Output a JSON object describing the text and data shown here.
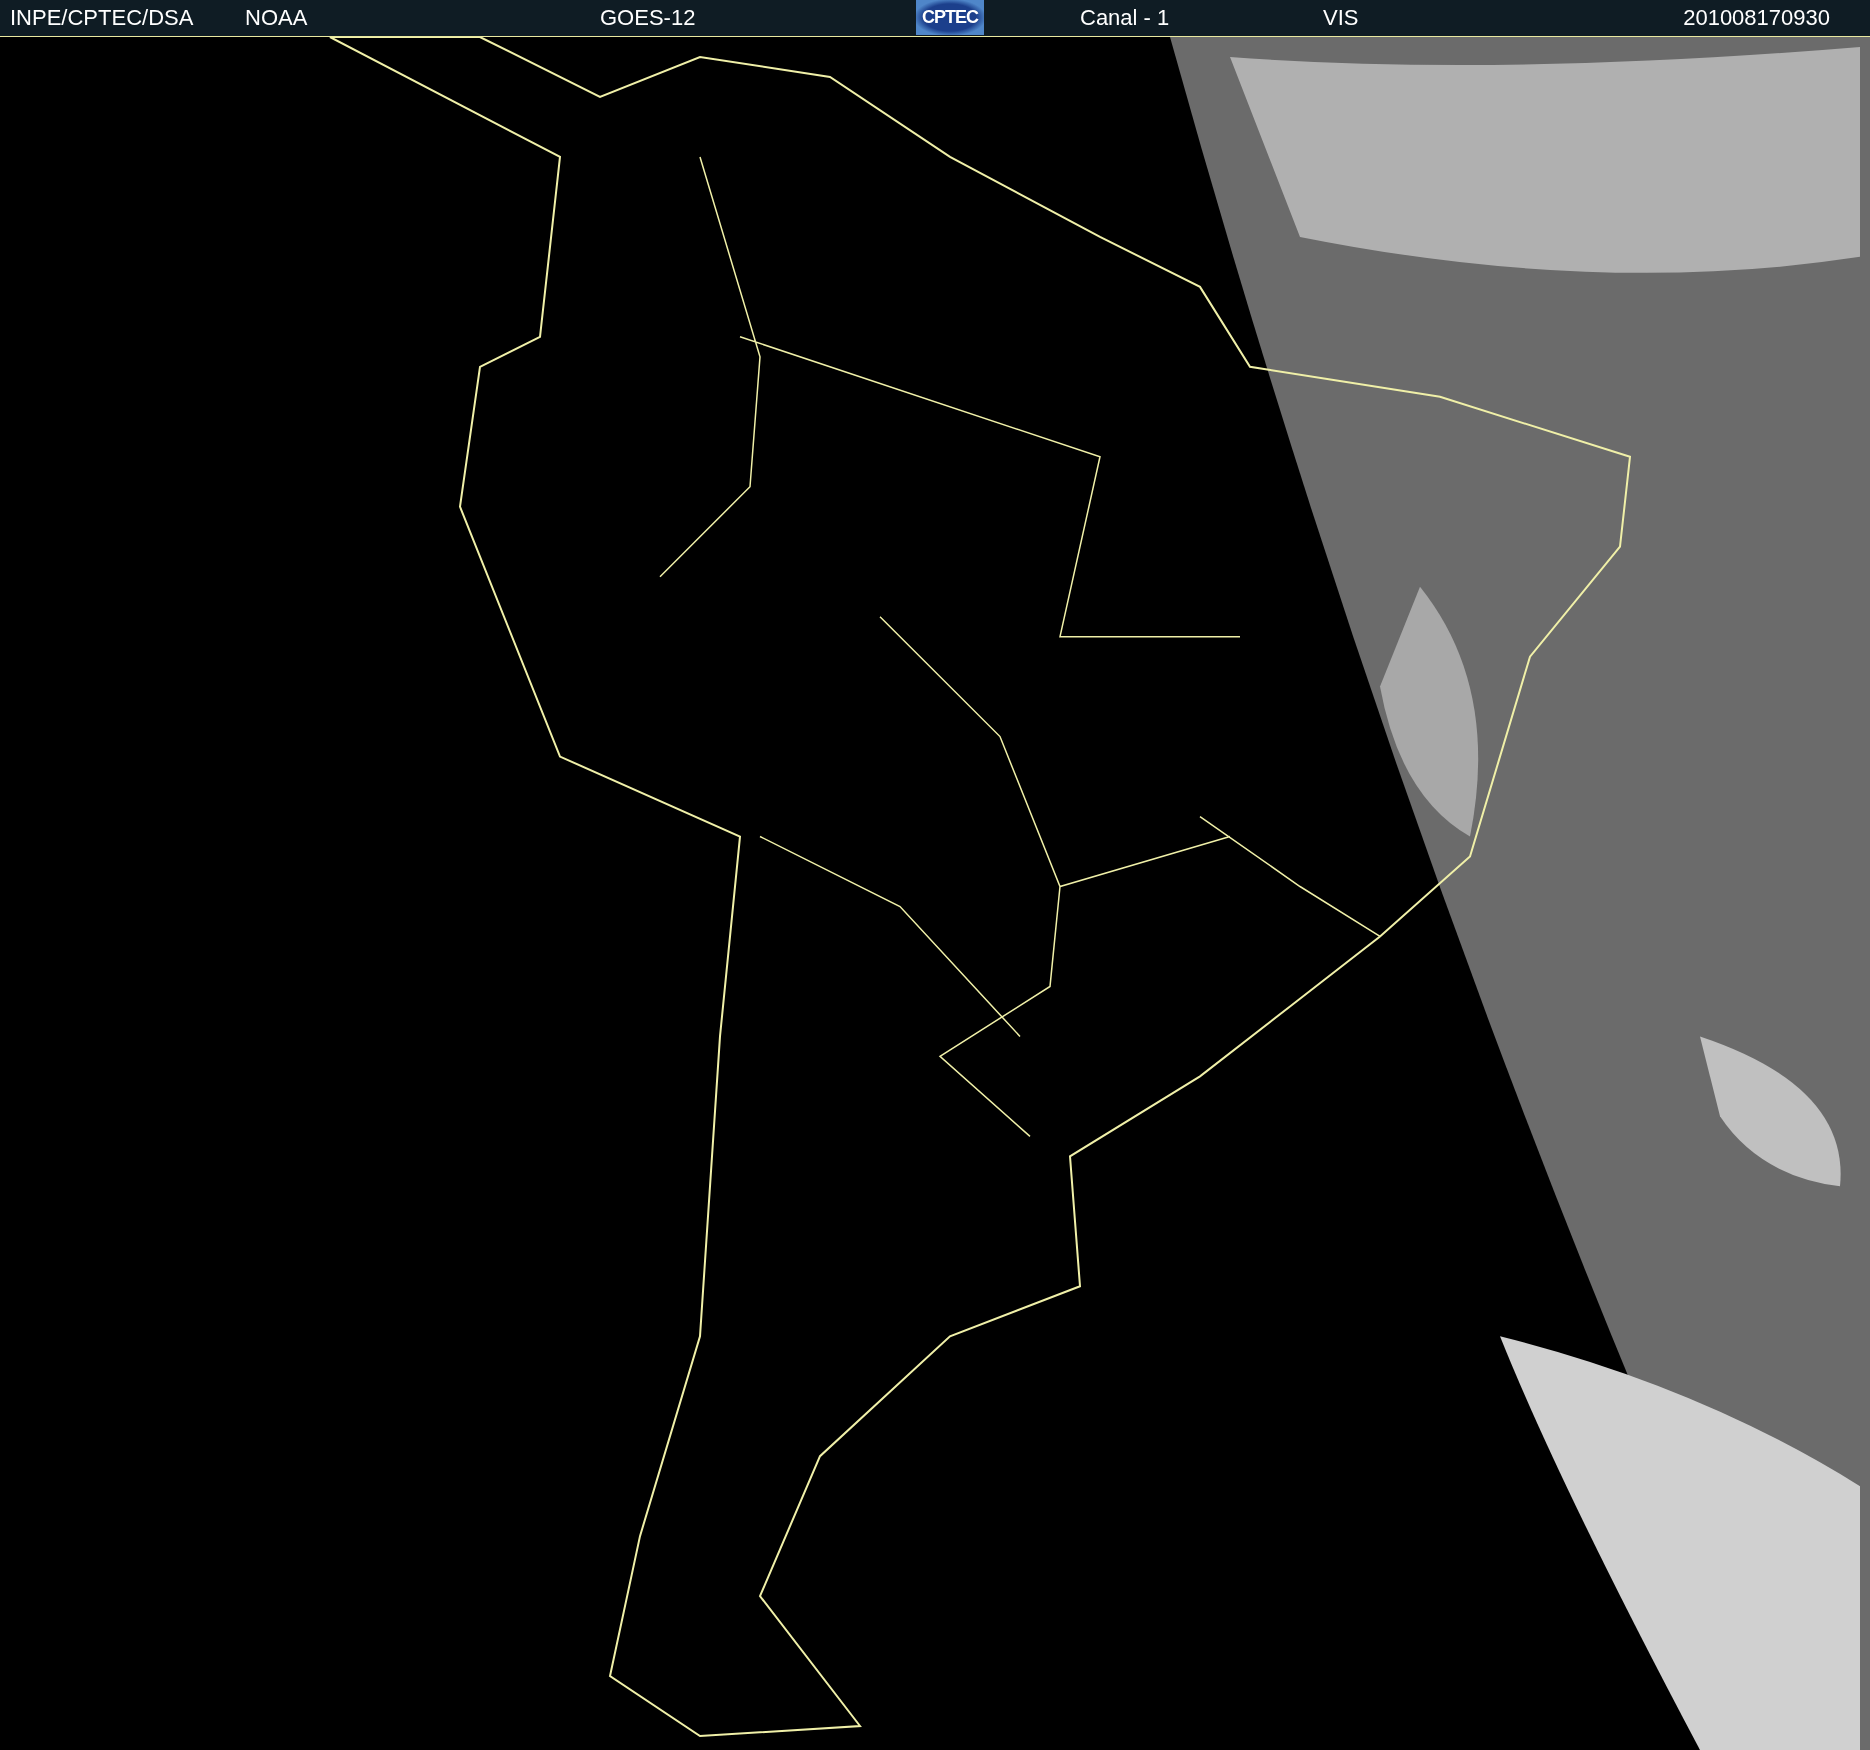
{
  "header": {
    "source": "INPE/CPTEC/DSA",
    "agency": "NOAA",
    "satellite": "GOES-12",
    "logo": "CPTEC",
    "channel": "Canal - 1",
    "band": "VIS",
    "timestamp": "201008170930"
  }
}
